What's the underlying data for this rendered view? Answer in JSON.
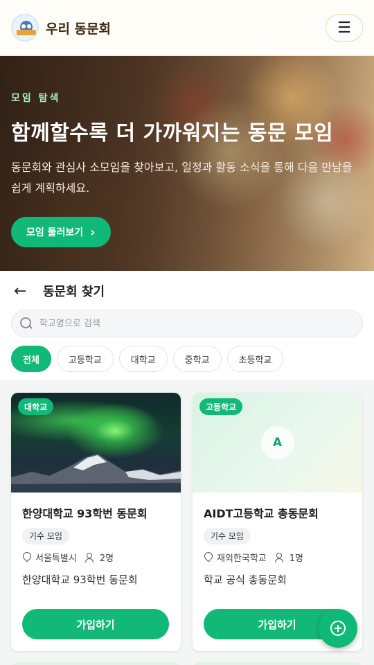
{
  "header": {
    "site_title": "우리 동문회",
    "menu_icon": "hamburger-icon",
    "menu_glyph": "☰"
  },
  "hero": {
    "eyebrow": "모임 탐색",
    "title": "함께할수록 더 가까워지는 동문 모임",
    "description": "동문회와 관심사 소모임을 찾아보고, 일정과 활동 소식을 통해 다음 만남을 쉽게 계획하세요.",
    "cta_label": "모임 둘러보기",
    "cta_glyph": "›"
  },
  "find": {
    "back_glyph": "←",
    "title": "동문회 찾기",
    "search_placeholder": "학교명으로 검색",
    "filters": [
      "전체",
      "고등학교",
      "대학교",
      "중학교",
      "초등학교"
    ],
    "active_filter": "전체"
  },
  "cards": [
    {
      "badge": "대학교",
      "title": "한양대학교 93학번 동문회",
      "tag": "기수 모임",
      "location": "서울특별시",
      "members": "2명",
      "description": "한양대학교 93학번 동문회",
      "join_label": "가입하기",
      "image": "aurora-mountain-photo"
    },
    {
      "badge": "고등학교",
      "title": "AIDT고등학교 총동문회",
      "tag": "기수 모임",
      "location": "재외한국학교",
      "members": "1명",
      "description": "학교 공식 총동문회",
      "join_label": "가입하기",
      "avatar_letter": "A"
    }
  ],
  "colors": {
    "accent": "#11b978",
    "eyebrow": "#a7f0c6",
    "title": "#3a2b10"
  }
}
